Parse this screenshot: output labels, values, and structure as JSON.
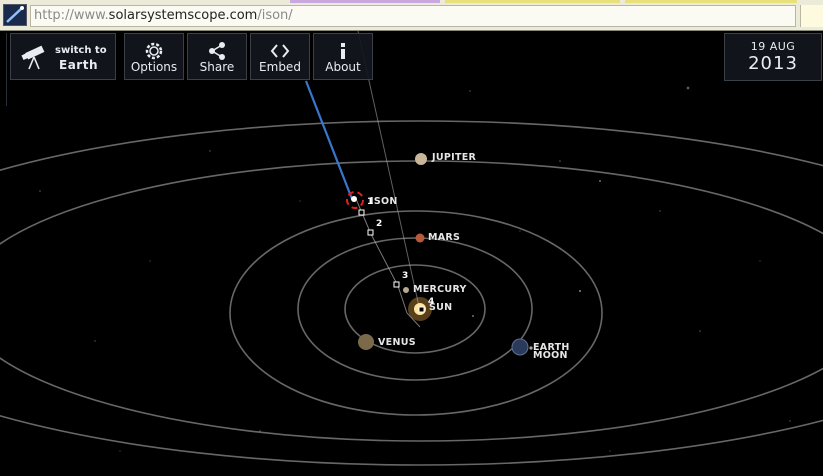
{
  "browser": {
    "url_scheme": "http://www.",
    "url_domain": "solarsystemscope.com",
    "url_path": "/ison/"
  },
  "toolbar": {
    "switch_line1": "switch to",
    "switch_line2": "Earth",
    "options_label": "Options",
    "share_label": "Share",
    "embed_label": "Embed",
    "about_label": "About"
  },
  "date": {
    "day_month": "19 AUG",
    "year": "2013"
  },
  "bodies": {
    "jupiter": "JUPITER",
    "ison": "ISON",
    "mars": "MARS",
    "mercury": "MERCURY",
    "sun": "SUN",
    "venus": "VENUS",
    "earth": "EARTH",
    "moon": "MOON"
  },
  "trajectory_markers": [
    "1",
    "2",
    "3",
    "4"
  ],
  "colors": {
    "background": "#000000",
    "orbit_line": "#8a8a8a",
    "ison_tail": "#3d7dd8",
    "ison_marker": "#e02020",
    "button_bg": "#12161c",
    "sun": "#ffcf6a"
  }
}
